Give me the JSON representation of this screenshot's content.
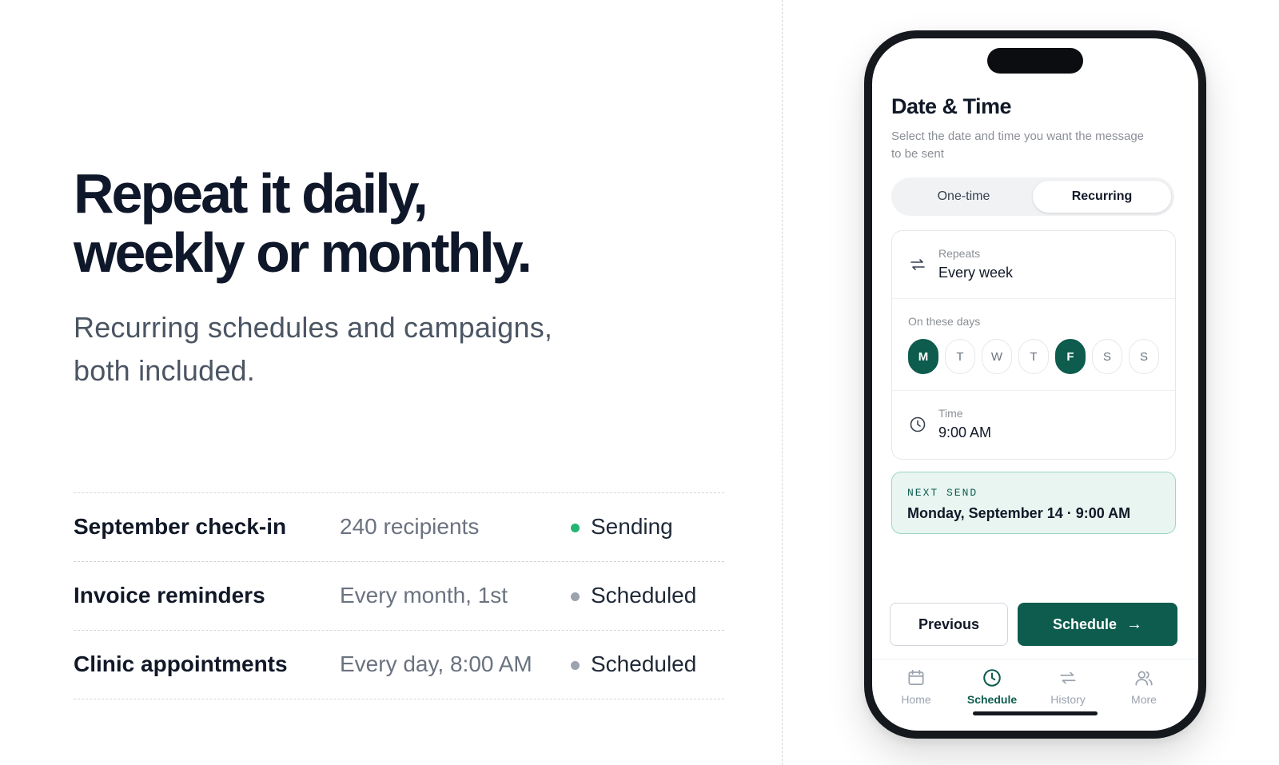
{
  "hero": {
    "headline_line1": "Repeat it daily,",
    "headline_line2": "weekly or monthly.",
    "subline_line1": "Recurring schedules and campaigns,",
    "subline_line2": "both included."
  },
  "campaigns": [
    {
      "name": "September check-in",
      "detail": "240 recipients",
      "status": "Sending",
      "status_color": "#22b573"
    },
    {
      "name": "Invoice reminders",
      "detail": "Every month, 1st",
      "status": "Scheduled",
      "status_color": "#9ca3af"
    },
    {
      "name": "Clinic appointments",
      "detail": "Every day, 8:00 AM",
      "status": "Scheduled",
      "status_color": "#9ca3af"
    }
  ],
  "phone": {
    "title": "Date & Time",
    "description": "Select the date and time you want the message to be sent",
    "segment": {
      "option1": "One-time",
      "option2": "Recurring",
      "selected": "Recurring"
    },
    "repeats": {
      "label": "Repeats",
      "value": "Every week",
      "icon": "repeat-icon"
    },
    "days": {
      "label": "On these days",
      "items": [
        {
          "letter": "M",
          "selected": true
        },
        {
          "letter": "T",
          "selected": false
        },
        {
          "letter": "W",
          "selected": false
        },
        {
          "letter": "T",
          "selected": false
        },
        {
          "letter": "F",
          "selected": true
        },
        {
          "letter": "S",
          "selected": false
        },
        {
          "letter": "S",
          "selected": false
        }
      ]
    },
    "time": {
      "label": "Time",
      "value": "9:00 AM",
      "icon": "clock-icon"
    },
    "next_send": {
      "label": "NEXT SEND",
      "value": "Monday, September 14 · 9:00 AM"
    },
    "buttons": {
      "previous": "Previous",
      "schedule": "Schedule",
      "schedule_icon": "arrow-right-icon"
    },
    "tabs": [
      {
        "label": "Home",
        "icon": "calendar-icon",
        "active": false
      },
      {
        "label": "Schedule",
        "icon": "clock-icon",
        "active": true
      },
      {
        "label": "History",
        "icon": "repeat-icon",
        "active": false
      },
      {
        "label": "More",
        "icon": "users-icon",
        "active": false
      }
    ]
  },
  "colors": {
    "accent": "#0d5c4d",
    "accent_light": "#e8f5f1",
    "sending": "#22b573",
    "scheduled": "#9ca3af"
  }
}
